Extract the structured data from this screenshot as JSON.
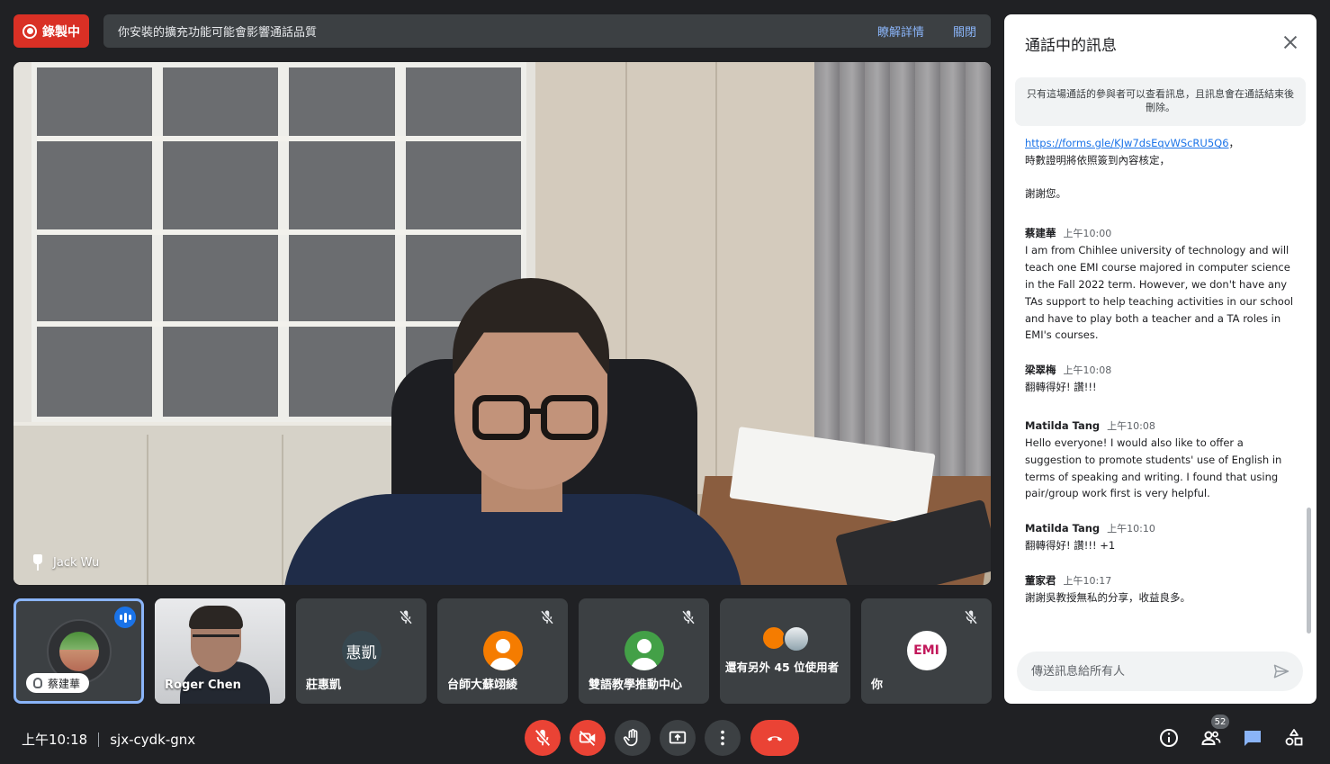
{
  "recording": {
    "label": "錄製中",
    "color": "#d93025"
  },
  "notice": {
    "text": "你安裝的擴充功能可能會影響通話品質",
    "learn_more": "瞭解詳情",
    "close": "關閉"
  },
  "main_video": {
    "participant_name": "Jack Wu",
    "icon": "pin-icon"
  },
  "tiles": [
    {
      "name": "蔡建華",
      "state": "speaking",
      "icon": "speaking-icon"
    },
    {
      "name": "Roger Chen",
      "state": "camera-on"
    },
    {
      "name": "莊惠凱",
      "avatar_text": "惠凱",
      "avatar_color": "#37474f",
      "muted": true
    },
    {
      "name": "台師大蘇翊綾",
      "avatar_color": "#f57c00",
      "muted": true
    },
    {
      "name": "雙語教學推動中心",
      "avatar_color": "#43a047",
      "muted": true
    },
    {
      "name": "還有另外 45 位使用者"
    },
    {
      "name": "你",
      "avatar_text": "EMI",
      "muted": true
    }
  ],
  "chat": {
    "title": "通話中的訊息",
    "notice": "只有這場通話的參與者可以查看訊息，且訊息會在通話結束後刪除。",
    "intro": {
      "link": "https://forms.gle/KJw7dsEqvWScRU5Q6",
      "link_suffix": "，",
      "line2": "時數證明將依照簽到內容核定，",
      "line3": "謝謝您。"
    },
    "messages": [
      {
        "sender": "蔡建華",
        "time": "上午10:00",
        "text": "I am from Chihlee university of technology and will teach one EMI course majored in computer science in the Fall 2022 term. However, we don't have any TAs support to help teaching activities in our school and have to play both a teacher and a TA roles in EMI's courses."
      },
      {
        "sender": "梁翠梅",
        "time": "上午10:08",
        "text": "翻轉得好! 讚!!!"
      },
      {
        "sender": "Matilda Tang",
        "time": "上午10:08",
        "text": "Hello everyone! I would also like to offer a suggestion to promote students' use of English in terms of speaking and writing. I found that using pair/group work first is very helpful."
      },
      {
        "sender": "Matilda Tang",
        "time": "上午10:10",
        "text": "翻轉得好! 讚!!! +1"
      },
      {
        "sender": "董家君",
        "time": "上午10:17",
        "text": "謝謝吳教授無私的分享，收益良多。"
      }
    ],
    "input_placeholder": "傳送訊息給所有人"
  },
  "footer": {
    "time": "上午10:18",
    "meeting_code": "sjx-cydk-gnx",
    "participant_count": "52"
  },
  "colors": {
    "accent": "#8ab4f8",
    "danger": "#ea4335",
    "surface": "#3c4043",
    "background": "#202124"
  }
}
